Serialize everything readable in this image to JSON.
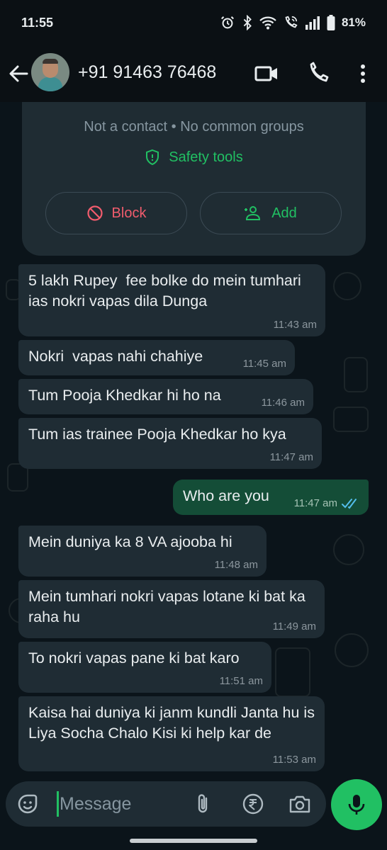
{
  "status_bar": {
    "time": "11:55",
    "battery": "81%"
  },
  "header": {
    "contact": "+91 91463 76468"
  },
  "info_card": {
    "subtitle": "Not a contact • No common groups",
    "safety_tools": "Safety tools",
    "block_label": "Block",
    "add_label": "Add"
  },
  "messages": [
    {
      "direction": "in",
      "text": "5 lakh Rupey  fee bolke do mein tumhari ias nokri vapas dila Dunga",
      "time": "11:43 am"
    },
    {
      "direction": "in",
      "text": "Nokri  vapas nahi chahiye",
      "time": "11:45 am"
    },
    {
      "direction": "in",
      "text": "Tum Pooja Khedkar hi ho na",
      "time": "11:46 am"
    },
    {
      "direction": "in",
      "text": "Tum ias trainee Pooja Khedkar ho kya",
      "time": "11:47 am"
    },
    {
      "direction": "out",
      "text": "Who are you",
      "time": "11:47 am",
      "status": "read"
    },
    {
      "direction": "in",
      "text": "Mein duniya ka 8 VA ajooba hi",
      "time": "11:48 am"
    },
    {
      "direction": "in",
      "text": "Mein tumhari nokri vapas lotane ki bat ka raha hu",
      "time": "11:49 am"
    },
    {
      "direction": "in",
      "text": "To nokri vapas pane ki bat karo",
      "time": "11:51 am"
    },
    {
      "direction": "in",
      "text": "Kaisa hai duniya ki janm kundli Janta hu is Liya Socha Chalo Kisi ki help kar de",
      "time": "11:53 am"
    }
  ],
  "composer": {
    "placeholder": "Message"
  },
  "colors": {
    "accent": "#21c063",
    "block": "#f15c6d",
    "incoming": "#1f2c34",
    "outgoing": "#144d37",
    "read_ticks": "#53bdeb"
  },
  "icons": [
    "alarm-icon",
    "bluetooth-icon",
    "wifi-icon",
    "wifi-calling-icon",
    "signal-icon",
    "battery-icon",
    "back-arrow-icon",
    "video-call-icon",
    "voice-call-icon",
    "more-menu-icon",
    "shield-icon",
    "block-icon",
    "add-person-icon",
    "sticker-icon",
    "attach-icon",
    "rupee-payment-icon",
    "camera-icon",
    "mic-icon",
    "double-check-icon"
  ]
}
